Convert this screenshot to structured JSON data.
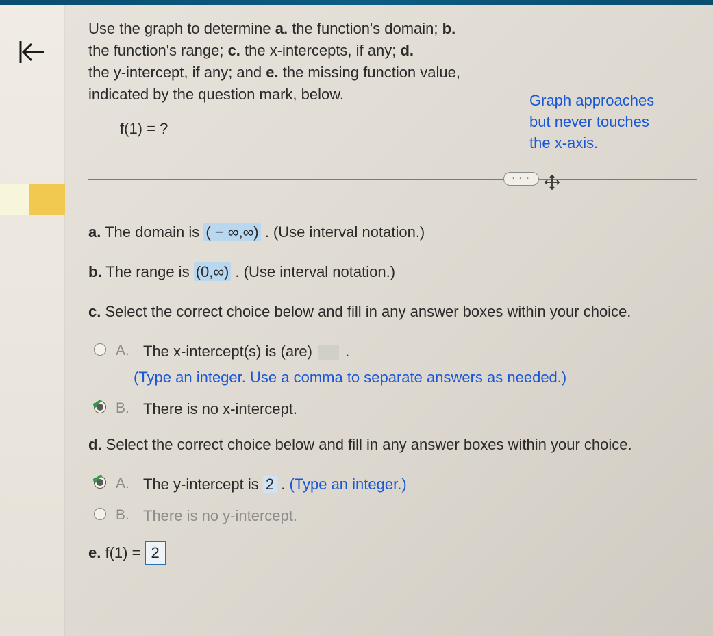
{
  "question": {
    "line1_pre": "Use the graph to determine ",
    "a_bold": "a.",
    "line1_post": " the function's domain; ",
    "b_bold": "b.",
    "line2_pre": "the function's range; ",
    "c_bold": "c.",
    "line2_mid": " the x-intercepts, if any; ",
    "d_bold": "d.",
    "line3_pre": "the y-intercept, if any; and ",
    "e_bold": "e.",
    "line3_post": " the missing function value,",
    "line4": "indicated by the question mark, below.",
    "f1q": "f(1) = ?"
  },
  "asymptote": {
    "l1": "Graph approaches",
    "l2": "but never touches",
    "l3": "the x-axis."
  },
  "sep": {
    "dots": "• • •"
  },
  "answers": {
    "a": {
      "label": "a.",
      "pre": " The domain is ",
      "val": "( − ∞,∞)",
      "post": " . (Use interval notation.)"
    },
    "b": {
      "label": "b.",
      "pre": " The range is ",
      "val": "(0,∞)",
      "post": " . (Use interval notation.)"
    },
    "c": {
      "label": "c.",
      "prompt": " Select the correct choice below and fill in any answer boxes within your choice.",
      "optA": {
        "letter": "A.",
        "t1": "The x-intercept(s) is (are) ",
        "t2": " .",
        "hint": "(Type an integer. Use a comma to separate answers as needed.)"
      },
      "optB": {
        "letter": "B.",
        "text": "There is no x-intercept."
      }
    },
    "d": {
      "label": "d.",
      "prompt": " Select the correct choice below and fill in any answer boxes within your choice.",
      "optA": {
        "letter": "A.",
        "t1": "The y-intercept is ",
        "val": "2",
        "t2": " . ",
        "hint": "(Type an integer.)"
      },
      "optB": {
        "letter": "B.",
        "text": "There is no y-intercept."
      }
    },
    "e": {
      "label": "e.",
      "pre": " f(1) = ",
      "val": "2"
    }
  }
}
